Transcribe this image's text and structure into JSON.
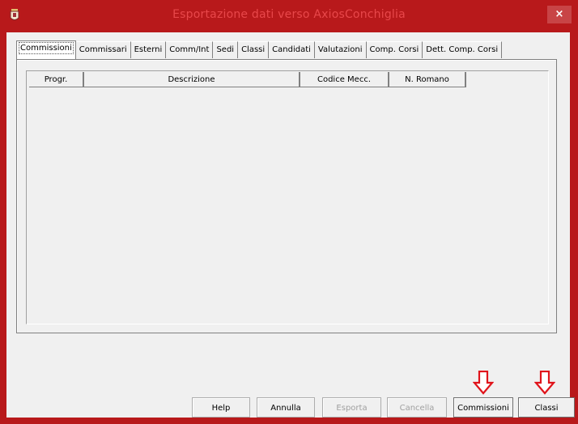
{
  "window": {
    "title": "Esportazione dati verso AxiosConchiglia",
    "close_glyph": "×",
    "accent_color": "#b8191b"
  },
  "tabs": [
    {
      "label": "Commissioni",
      "active": true
    },
    {
      "label": "Commissari"
    },
    {
      "label": "Esterni"
    },
    {
      "label": "Comm/Int"
    },
    {
      "label": "Sedi"
    },
    {
      "label": "Classi"
    },
    {
      "label": "Candidati"
    },
    {
      "label": "Valutazioni"
    },
    {
      "label": "Comp. Corsi"
    },
    {
      "label": "Dett. Comp. Corsi"
    }
  ],
  "grid": {
    "columns": [
      "Progr.",
      "Descrizione",
      "Codice Mecc.",
      "N. Romano"
    ],
    "rows": []
  },
  "buttons": {
    "help": "Help",
    "annulla": "Annulla",
    "esporta": "Esporta",
    "cancella": "Cancella",
    "commissioni": "Commissioni",
    "classi": "Classi"
  },
  "icons": {
    "app": "app-crest-icon",
    "arrow": "down-arrow-outline-icon",
    "arrow_color": "#e0141b"
  }
}
